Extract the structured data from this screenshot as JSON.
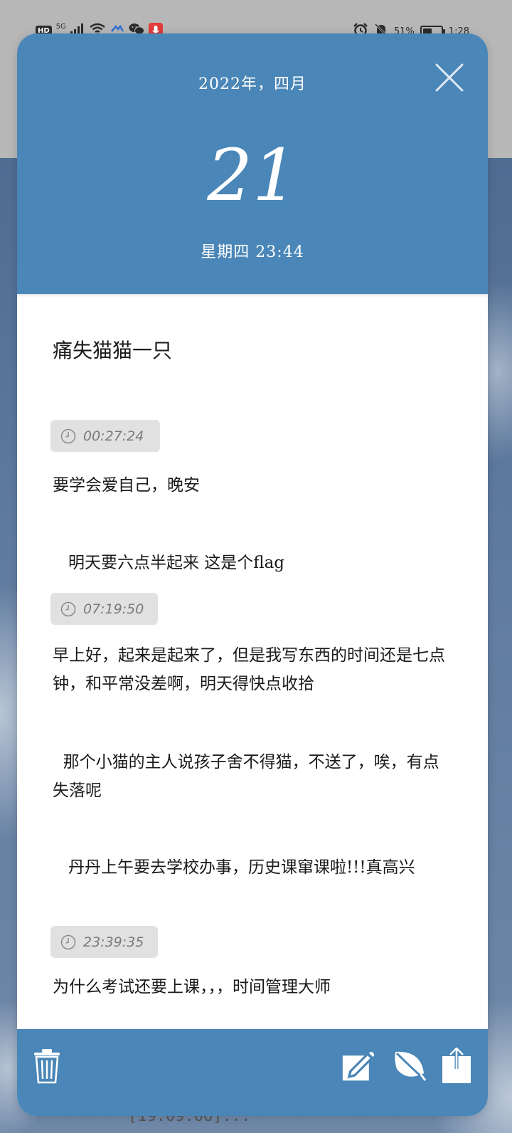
{
  "status_bar": {
    "hd": "HD",
    "network": "5G",
    "battery_percent": "51%",
    "battery_level": 0.51,
    "time": "1:28"
  },
  "colors": {
    "accent": "#4a86b7",
    "timestamp_bg": "#e1e1e1"
  },
  "header": {
    "month_title": "2022年，四月",
    "day": "21",
    "weekday_time": "星期四 23:44",
    "close_icon": "close-icon"
  },
  "note": {
    "title": "痛失猫猫一只",
    "entries": [
      {
        "timestamp": "00:27:24",
        "text": "要学会爱自己，晚安"
      },
      {
        "text": "   明天要六点半起来 这是个flag"
      },
      {
        "timestamp": "07:19:50",
        "text": "早上好，起来是起来了，但是我写东西的时间还是七点钟，和平常没差啊，明天得快点收拾"
      },
      {
        "text": "  那个小猫的主人说孩子舍不得猫，不送了，唉，有点失落呢"
      },
      {
        "text": "   丹丹上午要去学校办事，历史课窜课啦!!!真高兴"
      },
      {
        "timestamp": "23:39:35",
        "text": "为什么考试还要上课，，，时间管理大师"
      }
    ]
  },
  "footer": {
    "icons": [
      "trash-icon",
      "edit-icon",
      "leaf-icon",
      "share-icon"
    ]
  },
  "background_peek": "[19:09:06]..."
}
